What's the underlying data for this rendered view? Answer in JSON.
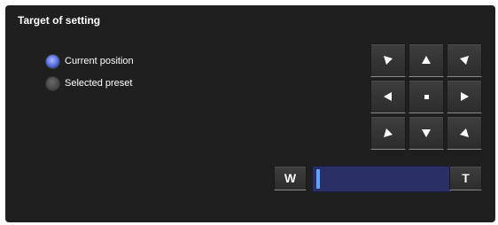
{
  "panel": {
    "title": "Target of setting"
  },
  "target_options": [
    {
      "label": "Current position",
      "selected": true
    },
    {
      "label": "Selected preset",
      "selected": false
    }
  ],
  "ptz_pad": {
    "buttons": [
      {
        "name": "pan-up-left",
        "icon": "arrow-up-left-icon"
      },
      {
        "name": "tilt-up",
        "icon": "arrow-up-icon"
      },
      {
        "name": "pan-up-right",
        "icon": "arrow-up-right-icon"
      },
      {
        "name": "pan-left",
        "icon": "arrow-left-icon"
      },
      {
        "name": "home",
        "icon": "home-dot-icon"
      },
      {
        "name": "pan-right",
        "icon": "arrow-right-icon"
      },
      {
        "name": "pan-down-left",
        "icon": "arrow-down-left-icon"
      },
      {
        "name": "tilt-down",
        "icon": "arrow-down-icon"
      },
      {
        "name": "pan-down-right",
        "icon": "arrow-down-right-icon"
      }
    ]
  },
  "zoom": {
    "wide_label": "W",
    "tele_label": "T",
    "level_fraction": 0.0
  },
  "colors": {
    "panel_bg": "#1f1f1f",
    "selected_radio": "#5f78e3",
    "zoom_track": "#2a2f63",
    "zoom_thumb": "#5fa2ff"
  }
}
